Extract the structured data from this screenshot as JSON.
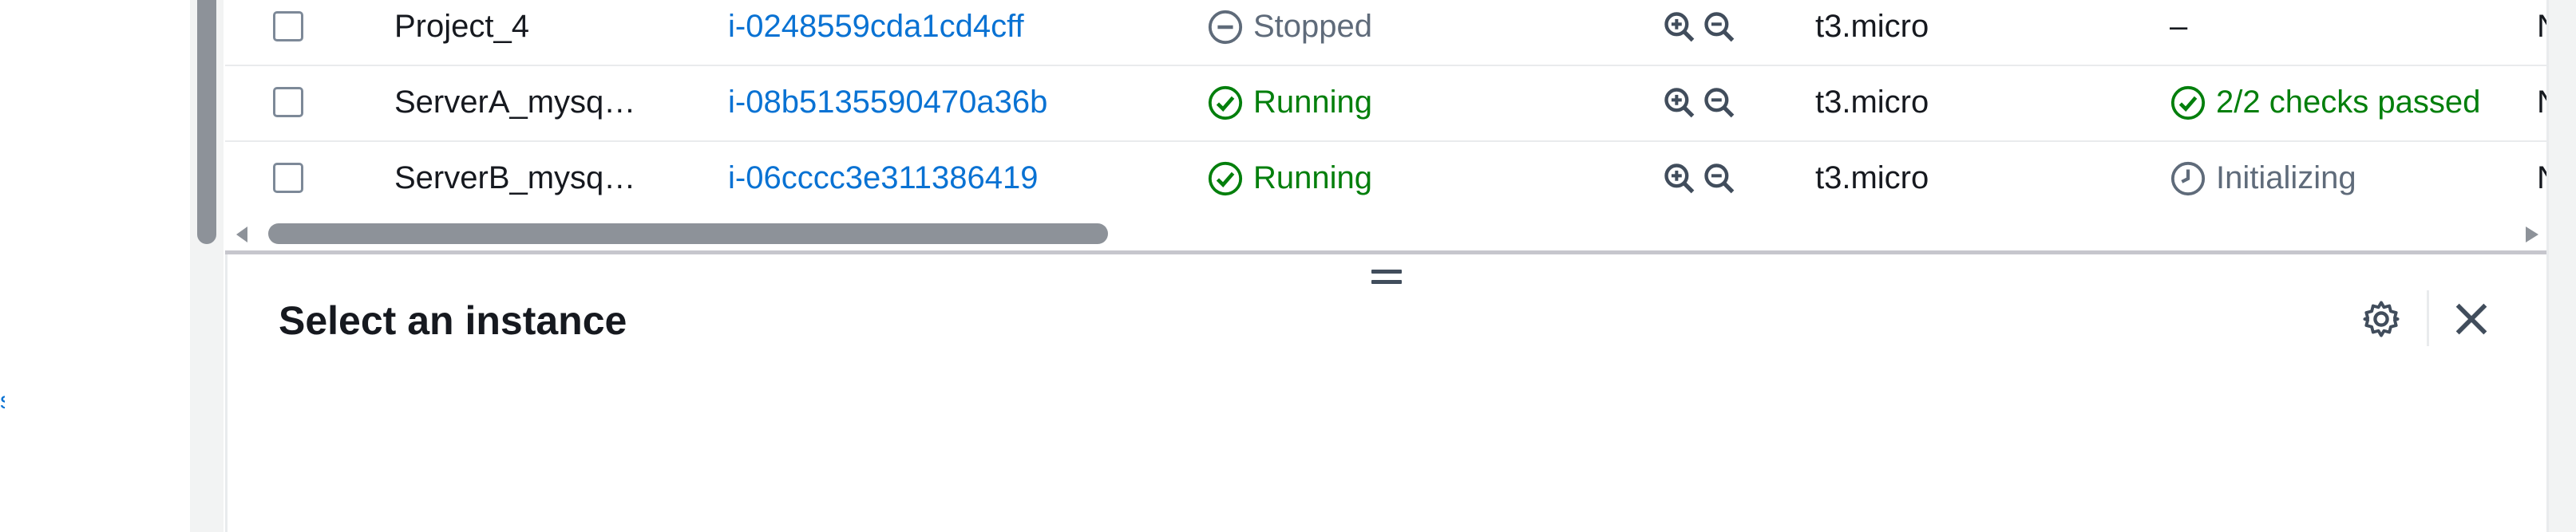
{
  "left_fragment": "s",
  "table": {
    "rows": [
      {
        "name": "Project_4",
        "instance_id": "i-0248559cda1cd4cff",
        "state": "Stopped",
        "state_icon": "stopped-icon",
        "instance_type": "t3.micro",
        "status_check": "–",
        "status_icon": "",
        "alarm": "No alarms"
      },
      {
        "name": "ServerA_mysq…",
        "instance_id": "i-08b5135590470a36b",
        "state": "Running",
        "state_icon": "running-icon",
        "instance_type": "t3.micro",
        "status_check": "2/2 checks passed",
        "status_icon": "check-passed-icon",
        "alarm": "No alarms"
      },
      {
        "name": "ServerB_mysq…",
        "instance_id": "i-06cccc3e311386419",
        "state": "Running",
        "state_icon": "running-icon",
        "instance_type": "t3.micro",
        "status_check": "Initializing",
        "status_icon": "initializing-icon",
        "alarm": "No alarms"
      }
    ]
  },
  "panel": {
    "title": "Select an instance"
  },
  "colors": {
    "link": "#0972d3",
    "success": "#037f0c",
    "muted": "#5f6b7a",
    "text": "#16191f",
    "divider": "#e9ebed"
  }
}
